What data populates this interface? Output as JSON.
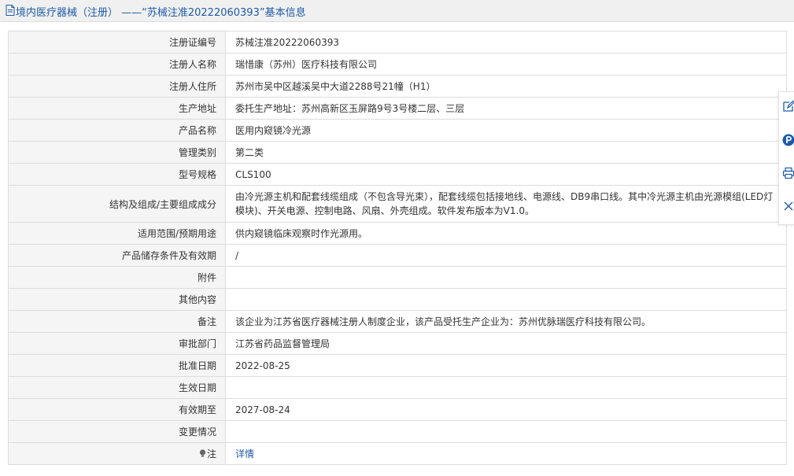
{
  "header": {
    "title": "境内医疗器械（注册） ——“苏械注准20222060393”基本信息"
  },
  "rows": [
    {
      "label": "注册证编号",
      "value": "苏械注准20222060393"
    },
    {
      "label": "注册人名称",
      "value": "瑞惜康（苏州）医疗科技有限公司"
    },
    {
      "label": "注册人住所",
      "value": "苏州市吴中区越溪吴中大道2288号21幢（H1）"
    },
    {
      "label": "生产地址",
      "value": "委托生产地址：苏州高新区玉屏路9号3号楼二层、三层"
    },
    {
      "label": "产品名称",
      "value": "医用内窥镜冷光源"
    },
    {
      "label": "管理类别",
      "value": "第二类"
    },
    {
      "label": "型号规格",
      "value": "CLS100"
    },
    {
      "label": "结构及组成/主要组成成分",
      "value": "由冷光源主机和配套线缆组成（不包含导光束），配套线缆包括接地线、电源线、DB9串口线。其中冷光源主机由光源模组(LED灯模块)、开关电源、控制电路、风扇、外壳组成。软件发布版本为V1.0。"
    },
    {
      "label": "适用范围/预期用途",
      "value": "供内窥镜临床观察时作光源用。"
    },
    {
      "label": "产品储存条件及有效期",
      "value": "/"
    },
    {
      "label": "附件",
      "value": ""
    },
    {
      "label": "其他内容",
      "value": ""
    },
    {
      "label": "备注",
      "value": "该企业为江苏省医疗器械注册人制度企业，该产品受托生产企业为：苏州优脉瑞医疗科技有限公司。"
    },
    {
      "label": "审批部门",
      "value": "江苏省药品监督管理局"
    },
    {
      "label": "批准日期",
      "value": "2022-08-25"
    },
    {
      "label": "生效日期",
      "value": ""
    },
    {
      "label": "有效期至",
      "value": "2027-08-24"
    },
    {
      "label": "变更情况",
      "value": ""
    }
  ],
  "note_row": {
    "label": "注",
    "link_text": "详情"
  },
  "side_tools": [
    "edit-icon",
    "p-badge-icon",
    "print-icon",
    "close-icon"
  ],
  "colors": {
    "title_blue": "#1e5aa8",
    "label_bg": "#f5f5f5",
    "border": "#dddddd",
    "header_bg": "#f0f0f0"
  }
}
